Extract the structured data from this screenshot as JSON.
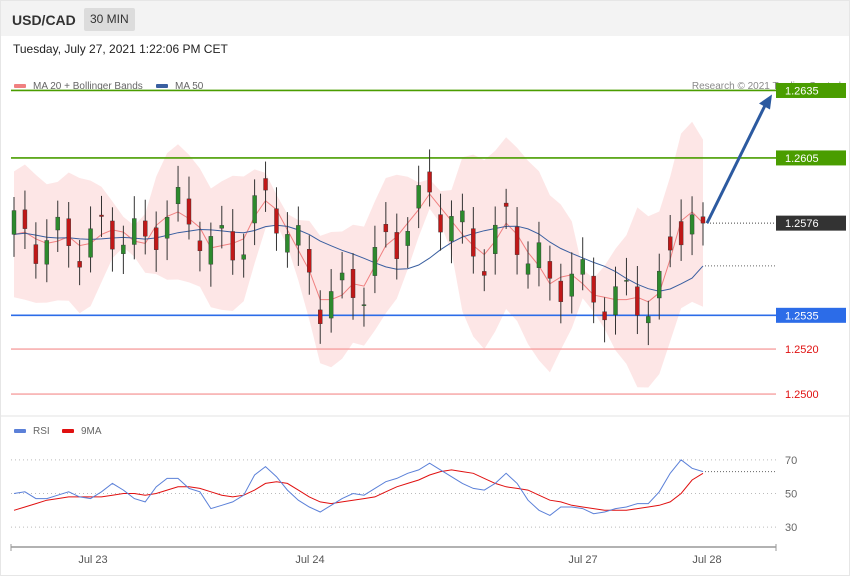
{
  "header": {
    "pair": "USD/CAD",
    "timeframe": "30 MIN"
  },
  "date_line": "Tuesday, July 27, 2021 1:22:06 PM CET",
  "legend_main": {
    "bb": "MA 20 + Bollinger Bands",
    "ma50": "MA 50"
  },
  "legend_rsi": {
    "rsi": "RSI",
    "ma9": "9MA"
  },
  "credit": "Research © 2021 Trading Central",
  "colors": {
    "resistance": "#4a9d00",
    "support": "#2c6ce8",
    "current": "#333333",
    "secondary_support": "#e01010",
    "bb": "#f08080",
    "ma50": "#3a5fa0",
    "rsi": "#5b80d8",
    "rsi_ma": "#e01010",
    "up": "#2d8a2d",
    "down": "#c01818"
  },
  "chart_data": [
    {
      "type": "line",
      "subtype": "candlestick",
      "instrument": "USD/CAD",
      "interval": "30 MIN",
      "x_tick_labels": [
        "Jul 23",
        "Jul 24",
        "Jul 27",
        "Jul 28"
      ],
      "ylim": [
        1.2492,
        1.2645
      ],
      "levels": [
        {
          "label": "1.2635",
          "value": 1.2635,
          "kind": "resistance"
        },
        {
          "label": "1.2605",
          "value": 1.2605,
          "kind": "resistance"
        },
        {
          "label": "1.2576",
          "value": 1.2576,
          "kind": "current"
        },
        {
          "label": "1.2535",
          "value": 1.2535,
          "kind": "support"
        },
        {
          "label": "1.2520",
          "value": 1.252,
          "kind": "secondary_support"
        },
        {
          "label": "1.2500",
          "value": 1.25,
          "kind": "secondary_support"
        }
      ],
      "projection": {
        "from": 1.2576,
        "to": 1.2635
      },
      "ma50_last": 1.2557,
      "series": [
        {
          "name": "MA 20 + Bollinger Bands",
          "values": [
            1.2571,
            1.2572,
            1.2569,
            1.2567,
            1.2568,
            1.257,
            1.2566,
            1.2567,
            1.2571,
            1.2573,
            1.2572,
            1.2568,
            1.2567,
            1.2575,
            1.2579,
            1.2581,
            1.2578,
            1.2574,
            1.2565,
            1.2566,
            1.2567,
            1.2569,
            1.2579,
            1.2586,
            1.2582,
            1.2573,
            1.2564,
            1.2555,
            1.2542,
            1.2542,
            1.2544,
            1.2549,
            1.2548,
            1.2557,
            1.2566,
            1.257,
            1.2576,
            1.2582,
            1.2589,
            1.2583,
            1.2577,
            1.2571,
            1.2566,
            1.2562,
            1.2568,
            1.2576,
            1.2571,
            1.2563,
            1.2557,
            1.2549,
            1.2552,
            1.2553,
            1.2549,
            1.2544,
            1.2543,
            1.2542,
            1.2542,
            1.2543,
            1.2541,
            1.2545,
            1.256,
            1.2577,
            1.2581,
            1.2576
          ]
        }
      ]
    },
    {
      "type": "line",
      "title": "RSI",
      "y_tick_labels": [
        "70",
        "50",
        "30"
      ],
      "ylim": [
        20,
        80
      ],
      "x": [
        "Jul 23",
        "Jul 24",
        "Jul 27",
        "Jul 28"
      ],
      "series": [
        {
          "name": "RSI",
          "values": [
            50,
            51,
            47,
            47,
            49,
            51,
            48,
            47,
            51,
            56,
            52,
            47,
            45,
            54,
            59,
            59,
            53,
            51,
            41,
            43,
            45,
            49,
            61,
            66,
            60,
            52,
            46,
            42,
            39,
            43,
            47,
            50,
            49,
            53,
            57,
            59,
            62,
            64,
            68,
            64,
            60,
            56,
            53,
            52,
            56,
            62,
            56,
            46,
            40,
            37,
            42,
            42,
            41,
            38,
            39,
            41,
            42,
            44,
            44,
            51,
            62,
            70,
            65,
            63
          ]
        },
        {
          "name": "9MA",
          "values": [
            40,
            42,
            44,
            46,
            47,
            48,
            48,
            48,
            48,
            49,
            50,
            50,
            49,
            50,
            52,
            54,
            54,
            53,
            51,
            49,
            48,
            49,
            52,
            56,
            57,
            56,
            52,
            48,
            45,
            44,
            45,
            46,
            47,
            48,
            51,
            54,
            56,
            58,
            61,
            63,
            64,
            63,
            62,
            59,
            56,
            54,
            53,
            52,
            49,
            46,
            45,
            43,
            42,
            41,
            40,
            40,
            40,
            41,
            42,
            43,
            45,
            50,
            58,
            62
          ]
        }
      ]
    }
  ]
}
